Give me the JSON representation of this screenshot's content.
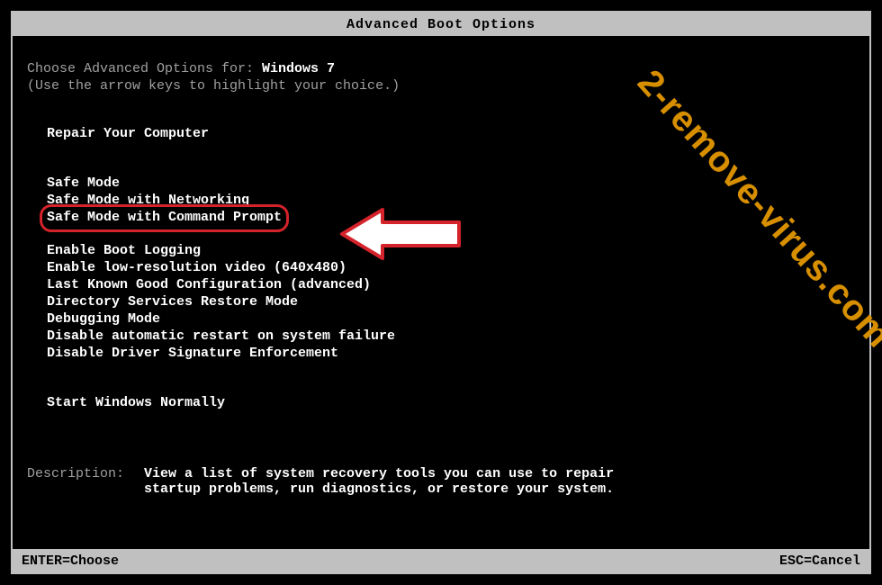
{
  "title": "Advanced Boot Options",
  "intro": {
    "prefix": "Choose Advanced Options for: ",
    "os": "Windows 7",
    "hint": "(Use the arrow keys to highlight your choice.)"
  },
  "options": {
    "repair": "Repair Your Computer",
    "safe_mode": "Safe Mode",
    "safe_mode_net": "Safe Mode with Networking",
    "safe_mode_cmd": "Safe Mode with Command Prompt",
    "boot_log": "Enable Boot Logging",
    "low_res": "Enable low-resolution video (640x480)",
    "last_known": "Last Known Good Configuration (advanced)",
    "ds_restore": "Directory Services Restore Mode",
    "debug": "Debugging Mode",
    "no_auto_restart": "Disable automatic restart on system failure",
    "no_driver_sig": "Disable Driver Signature Enforcement",
    "start_normal": "Start Windows Normally"
  },
  "description": {
    "label": "Description:",
    "text": "View a list of system recovery tools you can use to repair startup problems, run diagnostics, or restore your system."
  },
  "footer": {
    "enter": "ENTER=Choose",
    "esc": "ESC=Cancel"
  },
  "watermark": "2-remove-virus.com"
}
